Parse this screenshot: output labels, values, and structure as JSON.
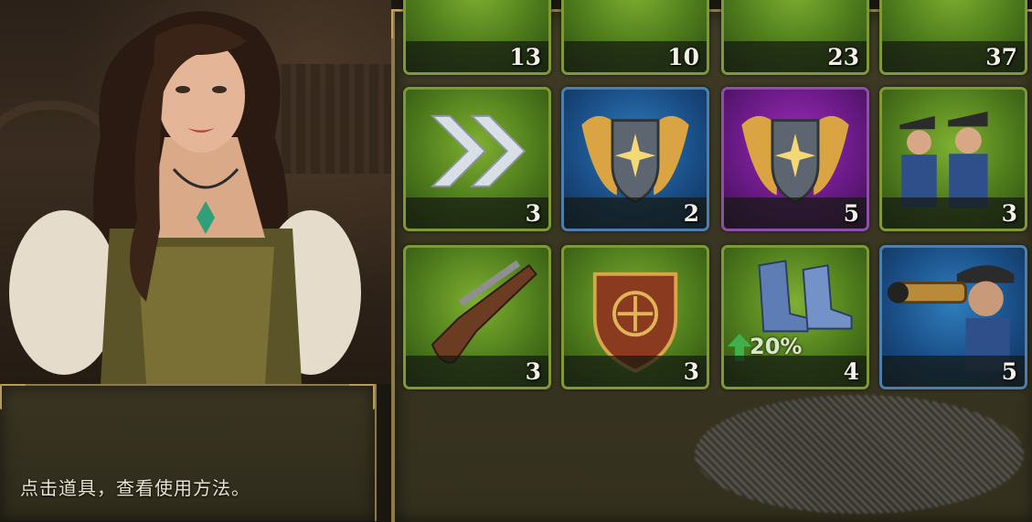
{
  "dialog": {
    "text": "点击道具，查看使用方法。"
  },
  "inventory": {
    "top_row": [
      {
        "count": "13"
      },
      {
        "count": "10"
      },
      {
        "count": "23"
      },
      {
        "count": "37"
      }
    ],
    "items": [
      {
        "name": "speedup-arrows",
        "icon": "double-arrow-icon",
        "rarity": "green",
        "count": "3"
      },
      {
        "name": "winged-shield-blue",
        "icon": "winged-shield-icon",
        "rarity": "blue",
        "count": "2"
      },
      {
        "name": "winged-shield-purple",
        "icon": "winged-shield-icon",
        "rarity": "purple",
        "count": "5"
      },
      {
        "name": "soldiers",
        "icon": "soldiers-icon",
        "rarity": "green",
        "count": "3"
      },
      {
        "name": "flintlock-pistol",
        "icon": "pistol-icon",
        "rarity": "green",
        "count": "3"
      },
      {
        "name": "crest-shield",
        "icon": "crest-shield-icon",
        "rarity": "green",
        "count": "3"
      },
      {
        "name": "march-speed-boots",
        "icon": "boots-icon",
        "rarity": "green",
        "count": "4",
        "boost": "20%"
      },
      {
        "name": "spyglass-scout",
        "icon": "spyglass-icon",
        "rarity": "blue",
        "count": "5"
      }
    ]
  },
  "colors": {
    "green": "#4e7b1c",
    "blue": "#1a4e86",
    "purple": "#6a1a86",
    "frame_gold": "#8c7a4a"
  }
}
